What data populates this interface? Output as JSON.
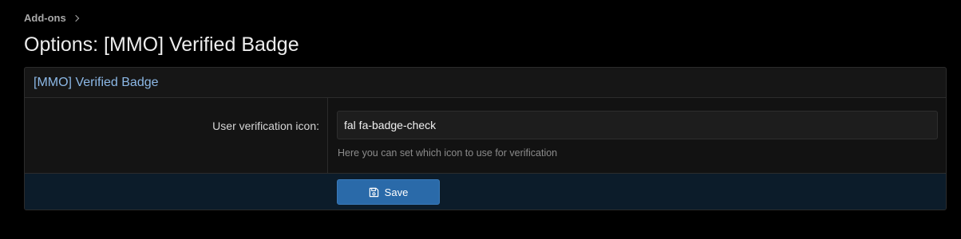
{
  "breadcrumb": {
    "items": [
      "Add-ons"
    ]
  },
  "page": {
    "title": "Options: [MMO] Verified Badge"
  },
  "block": {
    "header": "[MMO] Verified Badge",
    "option": {
      "label": "User verification icon:",
      "value": "fal fa-badge-check",
      "hint": "Here you can set which icon to use for verification"
    },
    "save_label": "Save"
  },
  "icons": {
    "breadcrumb_separator": "chevron-right-icon",
    "save": "floppy-disk-icon"
  },
  "colors": {
    "background": "#000000",
    "accent": "#2a6aa9",
    "header_text": "#8cb8e6",
    "submit_row": "#0c1c2a"
  }
}
